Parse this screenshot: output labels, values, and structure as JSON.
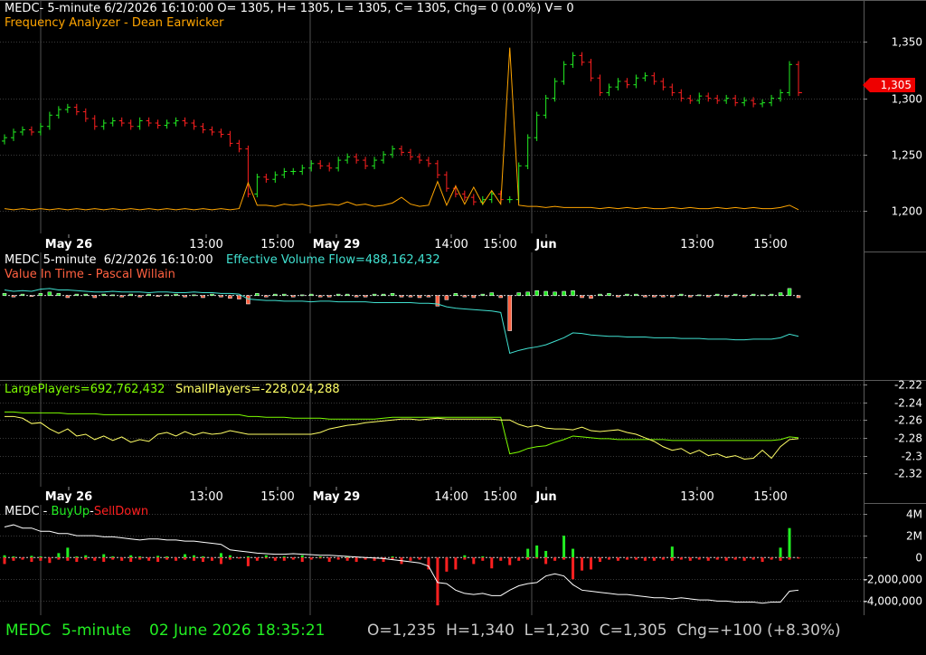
{
  "panel1": {
    "header": "MEDC- 5-minute 6/2/2026 16:10:00 O= 1305, H= 1305, L= 1305, C= 1305, Chg= 0 (0.0%) V= 0",
    "indicator": "Frequency Analyzer - Dean Earwicker",
    "last_price_label": "1,305"
  },
  "panel2": {
    "header": "MEDC 5-minute  6/2/2026 16:10:00",
    "efv_label": "Effective Volume Flow=488,162,432",
    "indicator": "Value In Time - Pascal Willain"
  },
  "panel3": {
    "large_label": "LargePlayers=692,762,432",
    "small_label": "SmallPlayers=-228,024,288"
  },
  "panel4": {
    "prefix": "MEDC - ",
    "buy_label": "BuyUp",
    "sep": "-",
    "sell_label": "SellDown"
  },
  "status": {
    "symbol": "MEDC",
    "interval": "5-minute",
    "datetime": "02 June 2026 18:35:21",
    "ohlc": "O=1,235  H=1,340  L=1,230  C=1,305  Chg=+100 (+8.30%)"
  },
  "colors": {
    "up": "#22ee22",
    "down": "#ff2020",
    "grid": "#3a3a3a",
    "frequency": "#ffa500",
    "efv": "#40e0d0",
    "value_in_time": "#ff6040",
    "large_players": "#7cfc00",
    "small_players": "#ffff66"
  },
  "chart_data": [
    {
      "type": "line",
      "name": "price",
      "x_ticks": [
        "May 26",
        "13:00",
        "15:00",
        "May 29",
        "14:00",
        "15:00",
        "Jun",
        "13:00",
        "15:00"
      ],
      "ylim": [
        1188,
        1368
      ],
      "y_ticks": [
        "1,350",
        "1,300",
        "1,250",
        "1,200"
      ],
      "y_tick_values": [
        1350,
        1300,
        1250,
        1200
      ],
      "series": [
        {
          "values": [
            1265,
            1270,
            1272,
            1270,
            1275,
            1285,
            1290,
            1292,
            1288,
            1282,
            1275,
            1278,
            1280,
            1278,
            1275,
            1280,
            1278,
            1276,
            1278,
            1280,
            1278,
            1275,
            1272,
            1270,
            1268,
            1260,
            1255,
            1215,
            1230,
            1228,
            1232,
            1235,
            1235,
            1238,
            1242,
            1240,
            1238,
            1245,
            1248,
            1245,
            1240,
            1245,
            1250,
            1255,
            1252,
            1248,
            1245,
            1242,
            1232,
            1220,
            1215,
            1212,
            1208,
            1210,
            1215,
            1210,
            1210,
            1240,
            1265,
            1285,
            1300,
            1315,
            1330,
            1338,
            1332,
            1318,
            1305,
            1310,
            1315,
            1312,
            1318,
            1320,
            1315,
            1310,
            1305,
            1300,
            1298,
            1302,
            1300,
            1298,
            1300,
            1296,
            1298,
            1295,
            1296,
            1300,
            1305,
            1330,
            1305
          ]
        },
        {
          "name": "Frequency Analyzer",
          "values": [
            1202,
            1201,
            1202,
            1201,
            1202,
            1201,
            1202,
            1201,
            1202,
            1201,
            1202,
            1201,
            1202,
            1201,
            1202,
            1201,
            1202,
            1201,
            1202,
            1201,
            1202,
            1201,
            1202,
            1201,
            1202,
            1201,
            1202,
            1225,
            1205,
            1205,
            1204,
            1206,
            1205,
            1206,
            1204,
            1205,
            1206,
            1205,
            1208,
            1205,
            1206,
            1204,
            1205,
            1207,
            1212,
            1206,
            1204,
            1205,
            1226,
            1205,
            1222,
            1206,
            1221,
            1206,
            1218,
            1206,
            1345,
            1205,
            1204,
            1204,
            1203,
            1204,
            1203,
            1203,
            1203,
            1203,
            1202,
            1203,
            1202,
            1203,
            1202,
            1203,
            1202,
            1202,
            1203,
            1202,
            1203,
            1202,
            1202,
            1203,
            1202,
            1203,
            1202,
            1203,
            1202,
            1202,
            1203,
            1205,
            1201
          ]
        }
      ]
    },
    {
      "type": "line",
      "name": "effective volume flow",
      "ylim": [
        -12,
        6
      ],
      "series": [
        {
          "name": "Effective Volume Flow",
          "values": [
            0.8,
            0.6,
            0.7,
            0.6,
            0.9,
            1.0,
            0.8,
            0.8,
            0.7,
            0.6,
            0.5,
            0.5,
            0.6,
            0.5,
            0.5,
            0.5,
            0.4,
            0.5,
            0.5,
            0.4,
            0.4,
            0.5,
            0.4,
            0.4,
            0.3,
            0.3,
            0.2,
            -0.5,
            -0.6,
            -0.7,
            -0.7,
            -0.8,
            -0.8,
            -0.8,
            -0.9,
            -0.8,
            -0.8,
            -0.9,
            -0.9,
            -0.9,
            -0.9,
            -1.0,
            -1.0,
            -1.0,
            -1.0,
            -1.0,
            -1.1,
            -1.1,
            -1.2,
            -1.6,
            -1.8,
            -1.9,
            -2.0,
            -2.1,
            -2.2,
            -2.4,
            -8.2,
            -7.8,
            -7.5,
            -7.3,
            -7.0,
            -6.5,
            -6.0,
            -5.3,
            -5.4,
            -5.6,
            -5.7,
            -5.8,
            -5.8,
            -5.9,
            -5.9,
            -5.9,
            -6.0,
            -6.0,
            -6.0,
            -6.1,
            -6.1,
            -6.1,
            -6.2,
            -6.2,
            -6.2,
            -6.3,
            -6.3,
            -6.2,
            -6.2,
            -6.2,
            -6.0,
            -5.5,
            -5.8
          ]
        },
        {
          "name": "Value In Time",
          "values": [
            0.3,
            -0.2,
            0.2,
            -0.1,
            0.3,
            0.5,
            0.3,
            -0.3,
            0.2,
            0.2,
            -0.3,
            0.2,
            0.1,
            -0.2,
            0.2,
            -0.2,
            0.2,
            -0.1,
            0.1,
            0.2,
            -0.2,
            0.1,
            -0.3,
            0.2,
            -0.2,
            -0.4,
            -0.5,
            -1.2,
            0.3,
            -0.2,
            0.2,
            0.2,
            -0.2,
            0.1,
            0.2,
            -0.2,
            -0.2,
            0.2,
            0.2,
            -0.2,
            -0.2,
            0.2,
            0.2,
            0.3,
            -0.2,
            -0.2,
            -0.3,
            -0.2,
            -1.5,
            -0.6,
            0.3,
            -0.2,
            -0.3,
            0.2,
            0.4,
            -0.3,
            -5.0,
            0.4,
            0.5,
            0.7,
            0.6,
            0.5,
            0.6,
            0.7,
            -0.3,
            -0.4,
            0.2,
            0.3,
            -0.2,
            0.2,
            0.2,
            -0.2,
            -0.2,
            -0.2,
            -0.2,
            0.2,
            -0.2,
            0.1,
            -0.2,
            0.2,
            -0.2,
            0.2,
            -0.2,
            0.2,
            0.1,
            0.2,
            0.4,
            1.0,
            -0.3
          ]
        }
      ]
    },
    {
      "type": "line",
      "name": "players",
      "x_ticks": [
        "May 26",
        "13:00",
        "15:00",
        "May 29",
        "14:00",
        "15:00",
        "Jun",
        "13:00",
        "15:00"
      ],
      "ylim": [
        -2.335,
        -2.215
      ],
      "y_ticks": [
        "-2.22",
        "-2.24",
        "-2.26",
        "-2.28",
        "-2.3",
        "-2.32"
      ],
      "y_tick_values": [
        -2.22,
        -2.24,
        -2.26,
        -2.28,
        -2.3,
        -2.32
      ],
      "series": [
        {
          "name": "LargePlayers",
          "values": [
            -2.251,
            -2.251,
            -2.252,
            -2.252,
            -2.252,
            -2.252,
            -2.252,
            -2.253,
            -2.253,
            -2.253,
            -2.253,
            -2.254,
            -2.254,
            -2.254,
            -2.254,
            -2.254,
            -2.254,
            -2.254,
            -2.254,
            -2.254,
            -2.254,
            -2.254,
            -2.254,
            -2.254,
            -2.254,
            -2.254,
            -2.254,
            -2.256,
            -2.256,
            -2.257,
            -2.257,
            -2.257,
            -2.258,
            -2.258,
            -2.258,
            -2.258,
            -2.259,
            -2.259,
            -2.259,
            -2.259,
            -2.259,
            -2.259,
            -2.258,
            -2.257,
            -2.257,
            -2.257,
            -2.257,
            -2.257,
            -2.257,
            -2.257,
            -2.257,
            -2.257,
            -2.257,
            -2.257,
            -2.257,
            -2.257,
            -2.298,
            -2.296,
            -2.292,
            -2.29,
            -2.289,
            -2.285,
            -2.282,
            -2.278,
            -2.279,
            -2.28,
            -2.281,
            -2.281,
            -2.282,
            -2.282,
            -2.282,
            -2.282,
            -2.282,
            -2.282,
            -2.283,
            -2.283,
            -2.283,
            -2.283,
            -2.283,
            -2.283,
            -2.283,
            -2.283,
            -2.283,
            -2.283,
            -2.283,
            -2.283,
            -2.282,
            -2.279,
            -2.28
          ]
        },
        {
          "name": "SmallPlayers",
          "values": [
            -2.256,
            -2.256,
            -2.258,
            -2.264,
            -2.263,
            -2.27,
            -2.275,
            -2.27,
            -2.278,
            -2.276,
            -2.282,
            -2.278,
            -2.283,
            -2.279,
            -2.285,
            -2.282,
            -2.284,
            -2.276,
            -2.274,
            -2.278,
            -2.273,
            -2.277,
            -2.274,
            -2.276,
            -2.275,
            -2.272,
            -2.274,
            -2.276,
            -2.276,
            -2.276,
            -2.276,
            -2.276,
            -2.276,
            -2.276,
            -2.276,
            -2.274,
            -2.27,
            -2.268,
            -2.266,
            -2.265,
            -2.263,
            -2.262,
            -2.261,
            -2.26,
            -2.259,
            -2.259,
            -2.26,
            -2.259,
            -2.258,
            -2.259,
            -2.259,
            -2.259,
            -2.259,
            -2.259,
            -2.259,
            -2.26,
            -2.26,
            -2.265,
            -2.268,
            -2.266,
            -2.269,
            -2.27,
            -2.27,
            -2.271,
            -2.268,
            -2.272,
            -2.273,
            -2.272,
            -2.271,
            -2.274,
            -2.276,
            -2.28,
            -2.284,
            -2.29,
            -2.294,
            -2.292,
            -2.298,
            -2.294,
            -2.3,
            -2.298,
            -2.302,
            -2.3,
            -2.304,
            -2.303,
            -2.294,
            -2.303,
            -2.29,
            -2.282,
            -2.281
          ]
        }
      ]
    },
    {
      "type": "bar",
      "name": "buyup-selldown",
      "ylim": [
        -5300000,
        5000000
      ],
      "y_ticks": [
        "4M",
        "2M",
        "0",
        "-2,000,000",
        "-4,000,000"
      ],
      "y_tick_values": [
        4000000,
        2000000,
        0,
        -2000000,
        -4000000
      ],
      "series": [
        {
          "name": "BuyUp",
          "values": [
            200000,
            100000,
            0,
            150000,
            100000,
            0,
            400000,
            900000,
            100000,
            200000,
            0,
            300000,
            100000,
            0,
            200000,
            100000,
            0,
            150000,
            100000,
            0,
            300000,
            200000,
            100000,
            0,
            400000,
            200000,
            0,
            100000,
            0,
            200000,
            0,
            100000,
            0,
            200000,
            0,
            100000,
            0,
            0,
            100000,
            0,
            0,
            0,
            0,
            100000,
            0,
            0,
            0,
            0,
            0,
            0,
            0,
            200000,
            0,
            100000,
            0,
            0,
            0,
            0,
            800000,
            1100000,
            600000,
            0,
            2000000,
            800000,
            0,
            0,
            0,
            0,
            0,
            0,
            0,
            0,
            0,
            0,
            1000000,
            0,
            0,
            0,
            0,
            0,
            0,
            0,
            0,
            0,
            0,
            0,
            900000,
            2700000,
            0
          ]
        },
        {
          "name": "SellDown",
          "values": [
            -600000,
            -300000,
            -200000,
            -400000,
            -300000,
            -500000,
            -200000,
            -300000,
            -400000,
            -200000,
            -300000,
            -400000,
            -200000,
            -300000,
            -400000,
            -200000,
            -300000,
            -400000,
            -200000,
            -300000,
            -200000,
            -300000,
            -400000,
            -300000,
            -600000,
            -200000,
            -100000,
            -800000,
            -300000,
            -100000,
            -300000,
            -300000,
            -200000,
            -400000,
            -200000,
            -100000,
            -400000,
            -200000,
            -300000,
            -400000,
            -200000,
            -300000,
            -400000,
            -200000,
            -600000,
            -300000,
            -200000,
            -1100000,
            -4400000,
            -1300000,
            -1100000,
            -200000,
            -600000,
            -300000,
            -1000000,
            -300000,
            -700000,
            -300000,
            -200000,
            -100000,
            -600000,
            -300000,
            -200000,
            -2000000,
            -1200000,
            -1100000,
            -400000,
            -200000,
            -300000,
            -200000,
            -200000,
            -300000,
            -300000,
            -200000,
            -300000,
            -200000,
            -300000,
            -200000,
            -300000,
            -200000,
            -300000,
            -200000,
            -300000,
            -200000,
            -400000,
            -200000,
            -300000,
            -200000,
            -100000
          ]
        },
        {
          "name": "Cumulative",
          "values": [
            2800000,
            3000000,
            2700000,
            2700000,
            2400000,
            2400000,
            2200000,
            2200000,
            2000000,
            2000000,
            2000000,
            1900000,
            1900000,
            1800000,
            1700000,
            1600000,
            1700000,
            1700000,
            1600000,
            1600000,
            1500000,
            1500000,
            1400000,
            1300000,
            1200000,
            700000,
            600000,
            500000,
            400000,
            350000,
            300000,
            300000,
            350000,
            300000,
            250000,
            200000,
            200000,
            150000,
            100000,
            50000,
            0,
            -50000,
            -100000,
            -200000,
            -300000,
            -400000,
            -500000,
            -800000,
            -2300000,
            -2400000,
            -3000000,
            -3300000,
            -3400000,
            -3300000,
            -3500000,
            -3500000,
            -3000000,
            -2600000,
            -2400000,
            -2300000,
            -1700000,
            -1500000,
            -1700000,
            -2500000,
            -3000000,
            -3100000,
            -3200000,
            -3300000,
            -3400000,
            -3400000,
            -3500000,
            -3600000,
            -3700000,
            -3700000,
            -3800000,
            -3700000,
            -3800000,
            -3900000,
            -3900000,
            -4000000,
            -4000000,
            -4100000,
            -4100000,
            -4100000,
            -4200000,
            -4100000,
            -4100000,
            -3100000,
            -3000000
          ]
        }
      ]
    }
  ]
}
